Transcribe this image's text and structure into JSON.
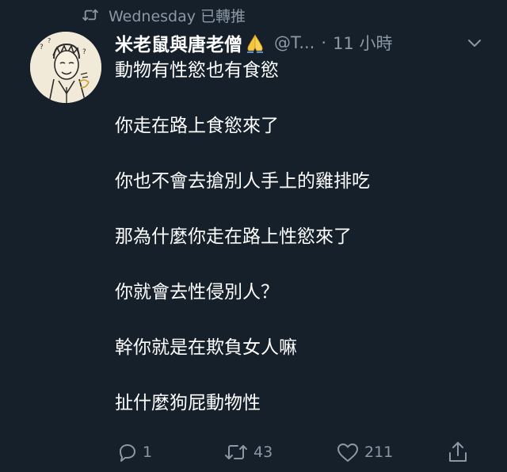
{
  "retweet_label": "Wednesday 已轉推",
  "tweet": {
    "display_name": "米老鼠與唐老僧",
    "handle": "@T...",
    "separator": "·",
    "time": "11 小時",
    "lines": [
      "動物有性慾也有食慾",
      "你走在路上食慾來了",
      "你也不會去搶別人手上的雞排吃",
      "那為什麼你走在路上性慾來了",
      "你就會去性侵別人？",
      "幹你就是在欺負女人嘛",
      "扯什麼狗屁動物性"
    ]
  },
  "actions": {
    "reply_count": "1",
    "retweet_count": "43",
    "like_count": "211"
  },
  "colors": {
    "background": "#15202b",
    "text": "#ffffff",
    "muted": "#8b98a5"
  },
  "icons": [
    "retweet-icon",
    "pray-emoji-icon",
    "chevron-down-icon",
    "reply-icon",
    "retweet-icon",
    "heart-icon",
    "share-icon"
  ]
}
